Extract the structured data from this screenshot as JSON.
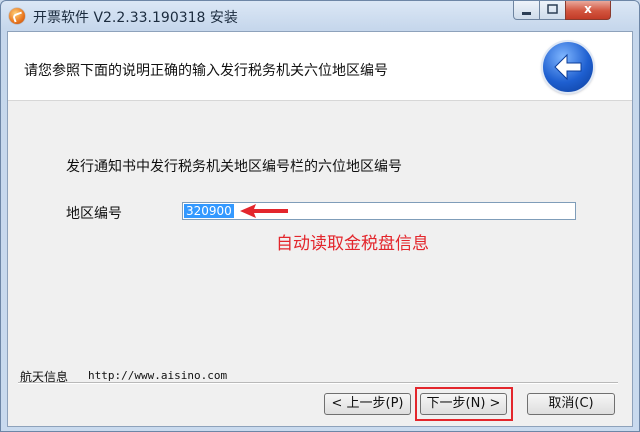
{
  "window": {
    "title": "开票软件 V2.2.33.190318 安装",
    "close_label": "x"
  },
  "header": {
    "instruction": "请您参照下面的说明正确的输入发行税务机关六位地区编号"
  },
  "content": {
    "description": "发行通知书中发行税务机关地区编号栏的六位地区编号",
    "region_label": "地区编号",
    "region_value": "320900",
    "annotation": "自动读取金税盘信息",
    "annotation_color": "#e3262c"
  },
  "footer": {
    "brand": "航天信息",
    "url": "http://www.aisino.com",
    "prev_button": "< 上一步(P)",
    "next_button": "下一步(N) >",
    "cancel_button": "取消(C)"
  }
}
